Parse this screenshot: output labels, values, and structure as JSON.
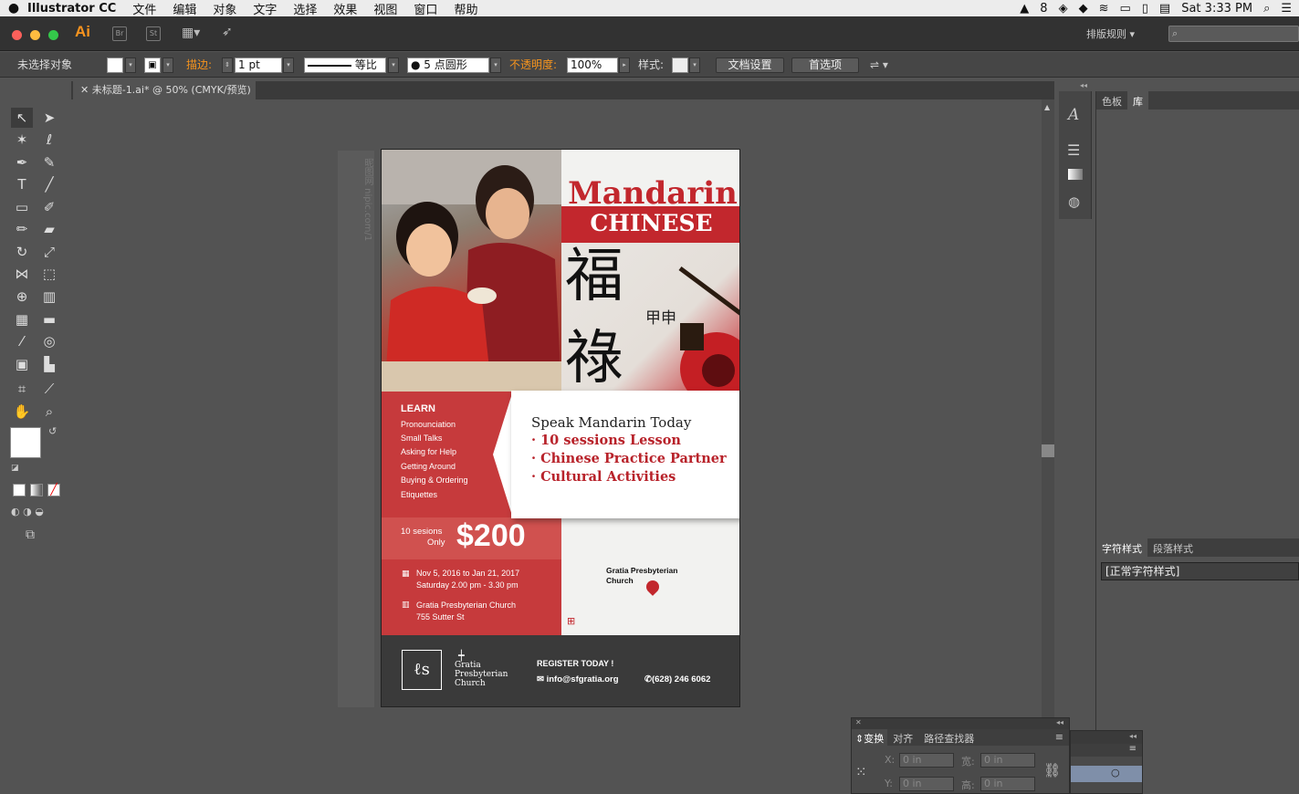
{
  "menubar": {
    "app_name": "Illustrator CC",
    "items": [
      "文件",
      "编辑",
      "对象",
      "文字",
      "选择",
      "效果",
      "视图",
      "窗口",
      "帮助"
    ],
    "adobe_count": "8",
    "clock": "Sat 3:33 PM"
  },
  "appbar": {
    "logo": "Ai",
    "bridge": "Br",
    "stock": "St",
    "layout_label": "排版规则"
  },
  "control": {
    "no_selection": "未选择对象",
    "stroke_label": "描边:",
    "stroke_value": "1 pt",
    "stroke_profile": "等比",
    "brush": "5 点圆形",
    "opacity_label": "不透明度:",
    "opacity_value": "100%",
    "style_label": "样式:",
    "doc_setup": "文档设置",
    "prefs": "首选项"
  },
  "document": {
    "tab_title": "未标题-1.ai* @ 50% (CMYK/预览)"
  },
  "panels": {
    "lib_tabs": [
      "色板",
      "库"
    ],
    "char_tabs": [
      "字符样式",
      "段落样式"
    ],
    "char_style_item": "[正常字符样式]",
    "transform_tabs": [
      "变换",
      "对齐",
      "路径查找器"
    ],
    "x_label": "X:",
    "y_label": "Y:",
    "w_label": "宽:",
    "h_label": "高:",
    "x_value": "0 in",
    "y_value": "0 in",
    "w_value": "0 in",
    "h_value": "0 in"
  },
  "poster": {
    "title1": "Mandarin",
    "title2": "CHINESE",
    "learn_heading": "LEARN",
    "learn_items": [
      "Pronounciation",
      "Small Talks",
      "Asking for Help",
      "Getting Around",
      "Buying & Ordering",
      "Etiquettes"
    ],
    "sessions_line1": "10 sesions",
    "sessions_line2": "Only",
    "price": "$200",
    "date_line1": "Nov 5, 2016 to Jan 21, 2017",
    "date_line2": "Saturday 2.00 pm - 3.30 pm",
    "venue_line1": "Gratia Presbyterian Church",
    "venue_line2": "755 Sutter St",
    "speak": "Speak Mandarin Today",
    "bullets": [
      "· 10 sessions  Lesson",
      "· Chinese Practice Partner",
      "· Cultural Activities"
    ],
    "map_label_1": "Gratia Presbyterian",
    "map_label_2": "Church",
    "church_name_1": "Gratia",
    "church_name_2": "Presbyterian",
    "church_name_3": "Church",
    "register": "REGISTER TODAY !",
    "email": "info@sfgratia.org",
    "phone": "(628) 246 6062",
    "watermark": "昵图网 nipic.com/1"
  },
  "colors": {
    "poster_red": "#c2272d",
    "ui_dark": "#323232",
    "ui_mid": "#535353",
    "accent_orange": "#f7941d"
  }
}
